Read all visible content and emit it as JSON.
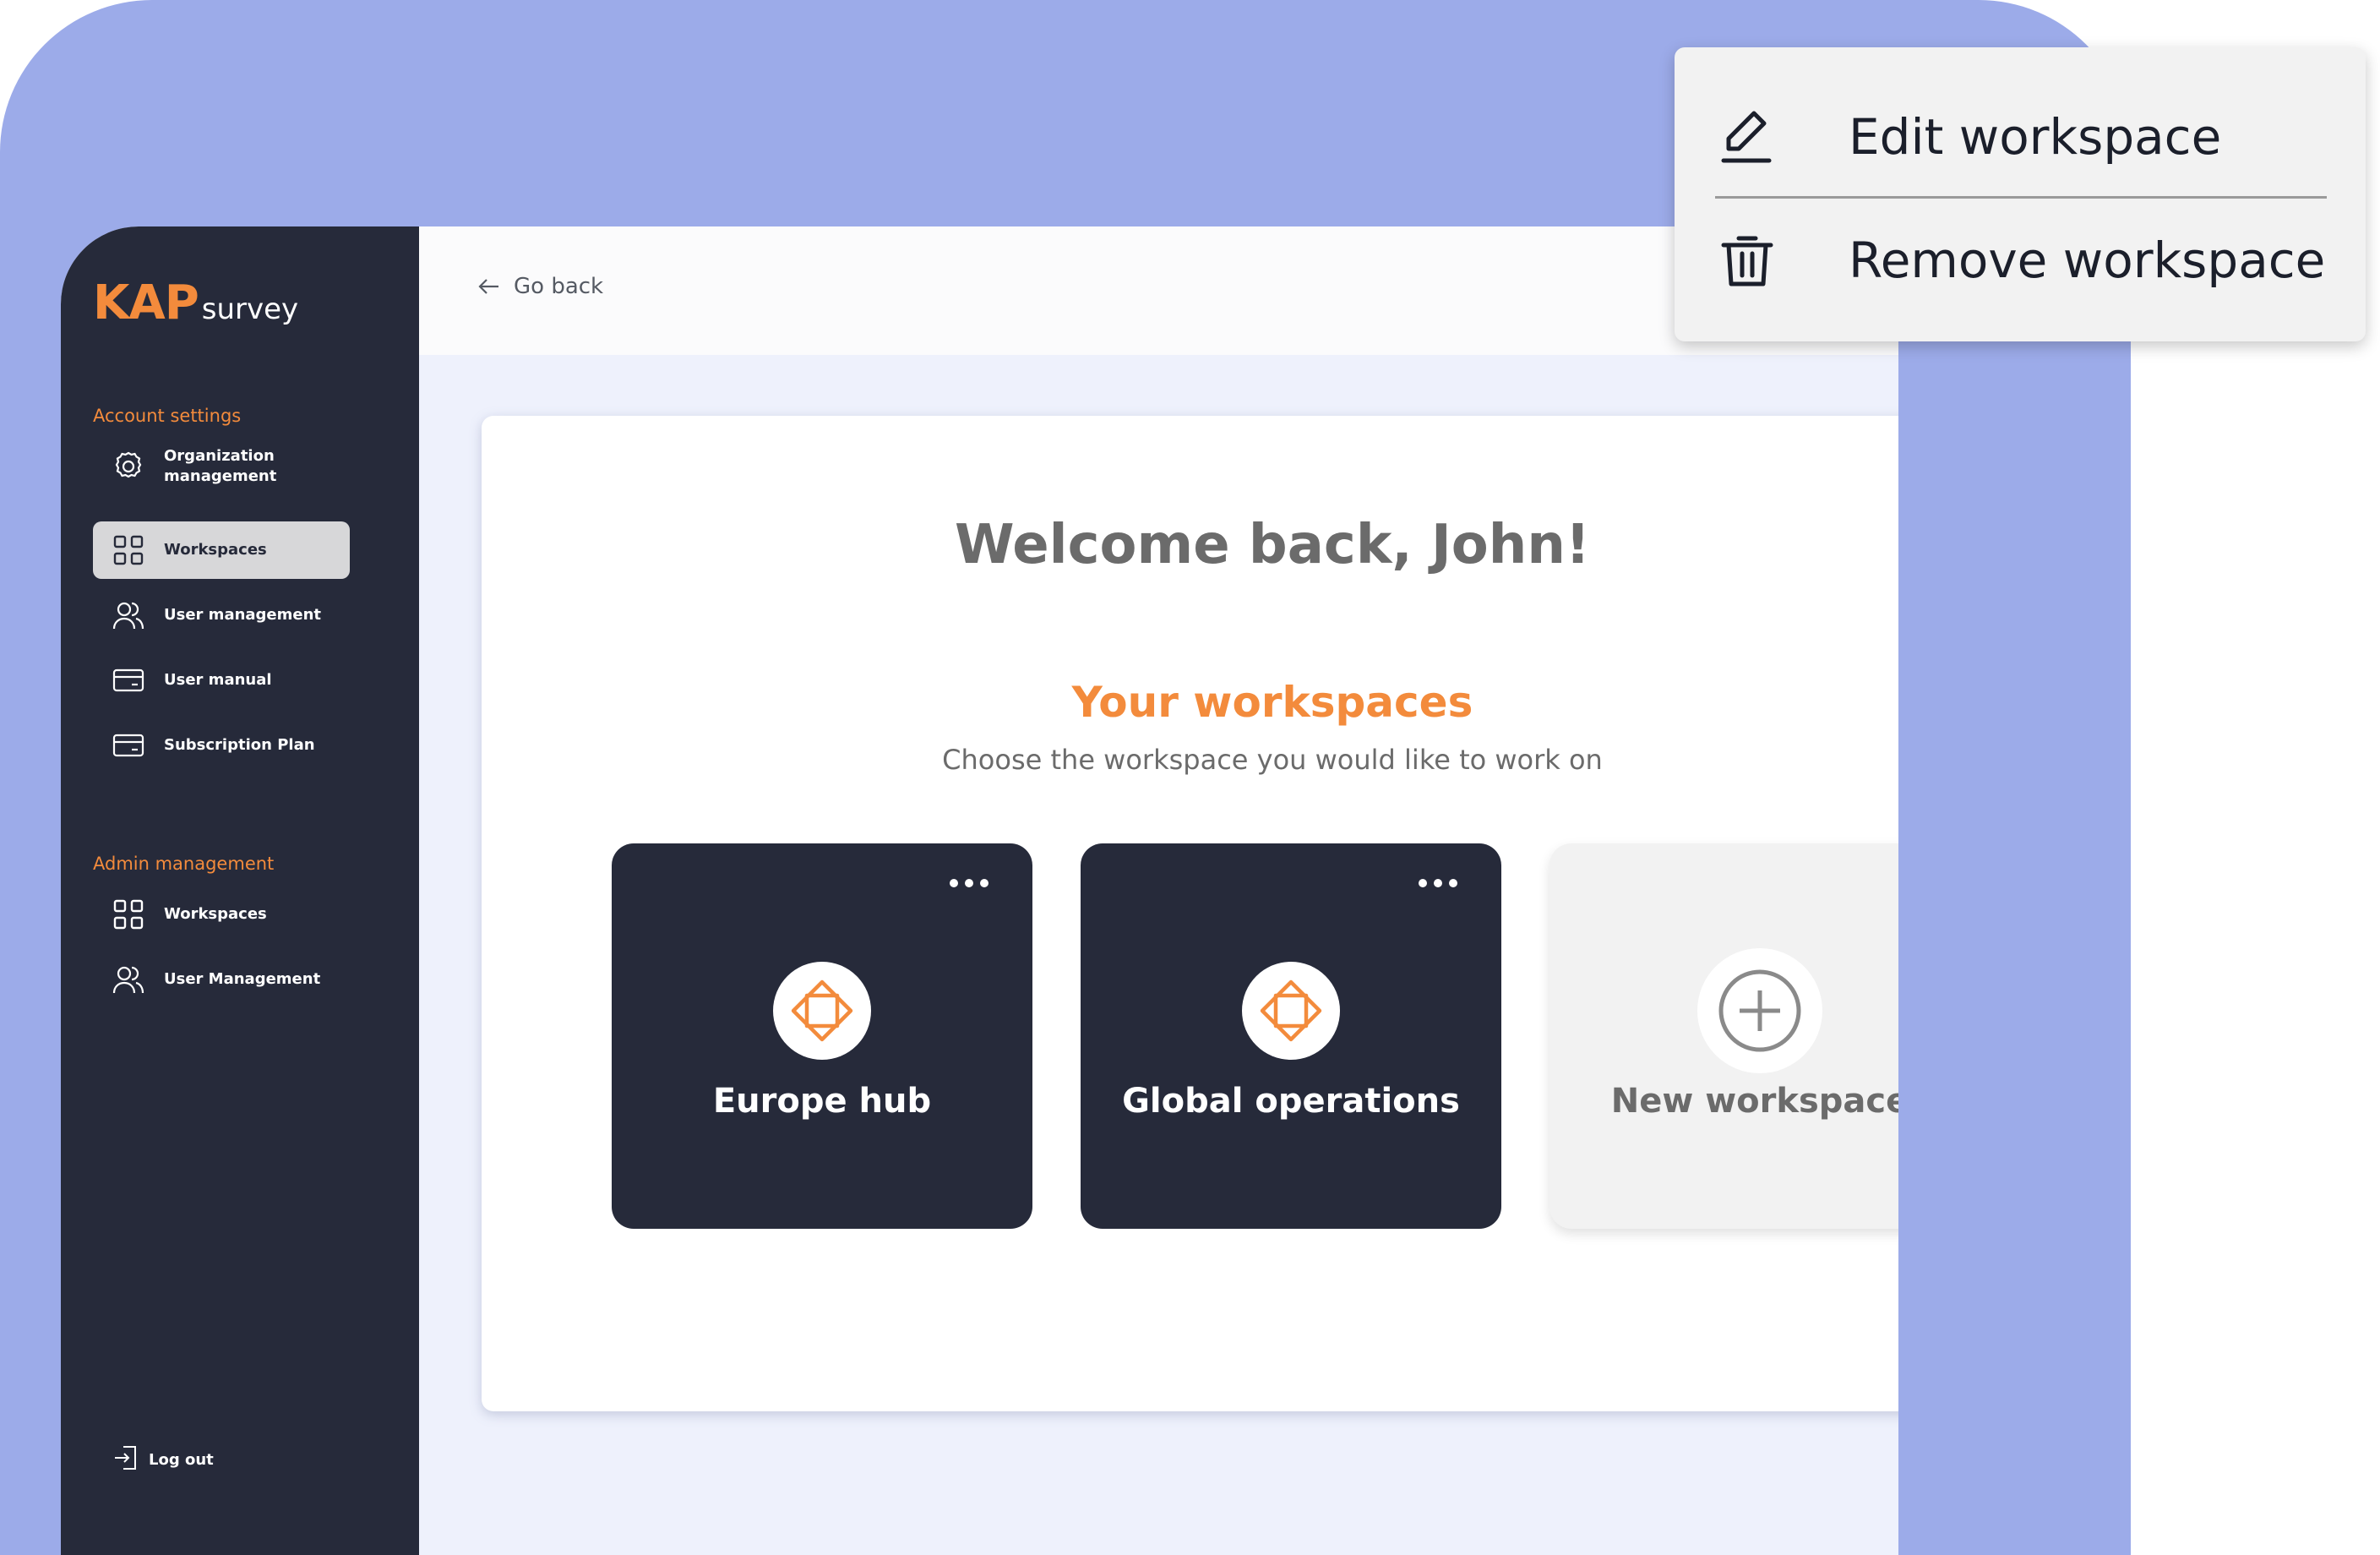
{
  "brand": {
    "name": "KAP",
    "suffix": "survey"
  },
  "sidebar": {
    "account_settings_title": "Account settings",
    "account_items": [
      {
        "label": "Organization management",
        "icon": "gear-icon"
      },
      {
        "label": "Workspaces",
        "icon": "grid-icon",
        "active": true
      },
      {
        "label": "User management",
        "icon": "users-icon"
      },
      {
        "label": "User manual",
        "icon": "card-icon"
      },
      {
        "label": "Subscription Plan",
        "icon": "card-icon"
      }
    ],
    "admin_title": "Admin management",
    "admin_items": [
      {
        "label": "Workspaces",
        "icon": "grid-icon"
      },
      {
        "label": "User Management",
        "icon": "users-icon"
      }
    ],
    "logout_label": "Log out"
  },
  "topbar": {
    "go_back_label": "Go back"
  },
  "main": {
    "welcome": "Welcome back, John!",
    "workspaces_title": "Your workspaces",
    "workspaces_subtitle": "Choose the workspace you would like to work on",
    "workspaces": [
      {
        "name": "Europe hub"
      },
      {
        "name": "Global operations"
      }
    ],
    "new_workspace_label": "New workspace"
  },
  "context_menu": {
    "edit_label": "Edit workspace",
    "remove_label": "Remove workspace"
  },
  "colors": {
    "accent": "#f38b3c",
    "sidebar": "#262a3a",
    "backdrop": "#9cabe9"
  }
}
